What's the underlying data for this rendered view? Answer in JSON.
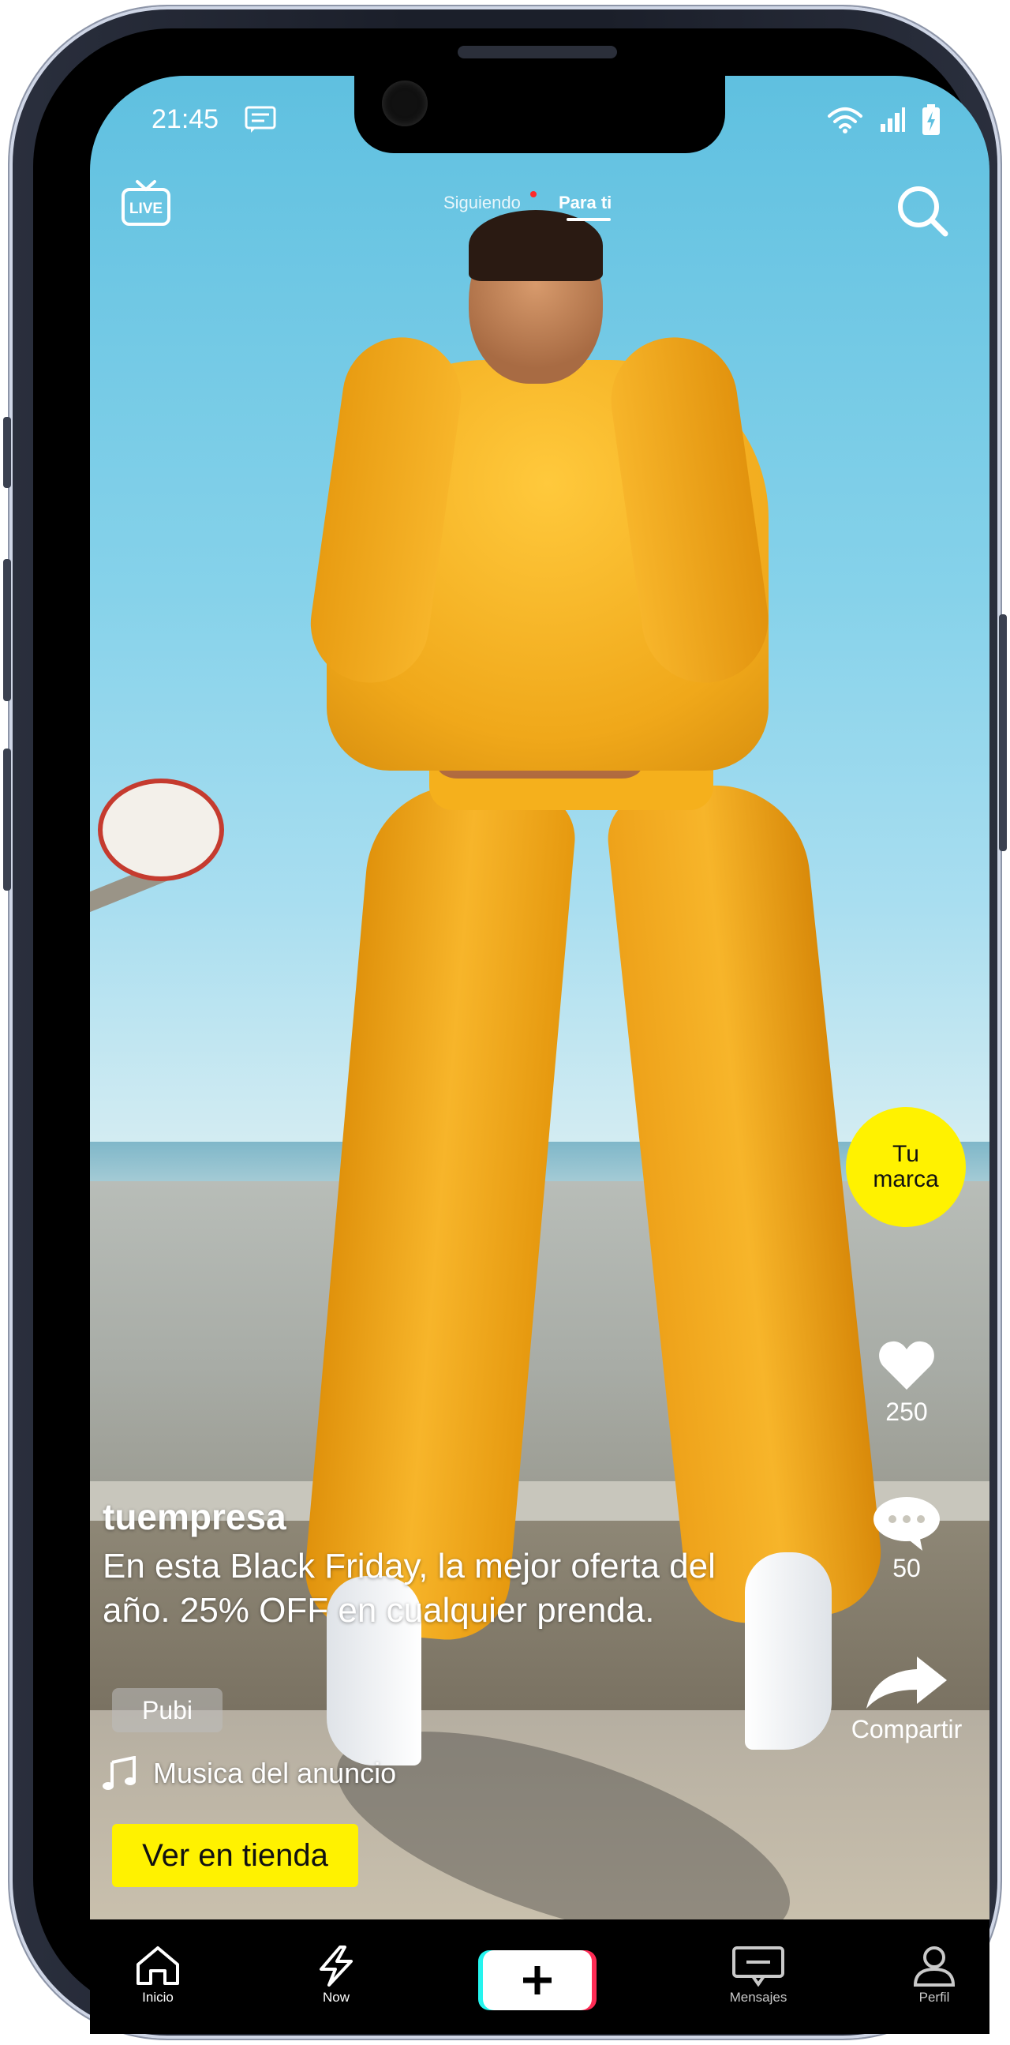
{
  "status_bar": {
    "time": "21:45",
    "icons": [
      "message-icon",
      "wifi-icon",
      "signal-icon",
      "battery-charging-icon"
    ]
  },
  "top_nav": {
    "live_label": "LIVE",
    "tabs": [
      {
        "label": "Siguiendo",
        "active": false
      },
      {
        "label": "Para ti",
        "active": true
      }
    ],
    "icons": [
      "live-tv-icon",
      "search-icon"
    ]
  },
  "side_actions": {
    "brand_avatar": "Tu marca",
    "likes": "250",
    "comments": "50",
    "share_label": "Compartir",
    "icons": [
      "heart-icon",
      "comment-icon",
      "share-icon"
    ]
  },
  "post": {
    "username": "tuempresa",
    "caption": "En esta Black Friday, la mejor oferta del año. 25% OFF en cualquier prenda.",
    "ad_tag": "Pubi",
    "music": "Musica del anuncio",
    "cta_label": "Ver en tienda",
    "icons": [
      "music-note-icon"
    ]
  },
  "bottom_nav": {
    "items": [
      {
        "label": "Inicio",
        "icon": "home-icon"
      },
      {
        "label": "Now",
        "icon": "lightning-icon"
      },
      {
        "label": "",
        "icon": "plus-icon"
      },
      {
        "label": "Mensajes",
        "icon": "message-icon"
      },
      {
        "label": "Perfil",
        "icon": "user-icon"
      }
    ]
  },
  "colors": {
    "accent_yellow": "#fff200",
    "create_cyan": "#25f4ee",
    "create_red": "#fe2c55",
    "notification_dot": "#ff2a2a"
  }
}
